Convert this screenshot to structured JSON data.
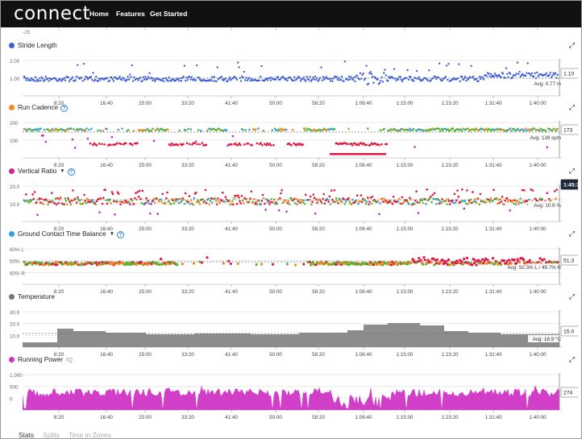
{
  "header": {
    "logo_text": "connect",
    "nav": [
      "Home",
      "Features",
      "Get Started"
    ]
  },
  "x_ticks": [
    "8:20",
    "16:40",
    "25:00",
    "33:20",
    "41:40",
    "50:00",
    "58:20",
    "1:06:40",
    "1:15:00",
    "1:23:20",
    "1:31:40",
    "1:40:00"
  ],
  "top_fragment": {
    "y_label": "-25"
  },
  "panels": [
    {
      "id": "stride-length",
      "title": "Stride Length",
      "dot_color": "#3b5fd8",
      "help": false,
      "dropdown": false,
      "io_label": "",
      "y_labels": [
        "2.00",
        "1.00"
      ],
      "avg_label": "Avg: 0.77 m",
      "value_tag": "1.10",
      "value_tag_dark": false
    },
    {
      "id": "run-cadence",
      "title": "Run Cadence",
      "dot_color": "#f28a1e",
      "help": true,
      "dropdown": false,
      "io_label": "",
      "y_labels": [
        "200",
        "100"
      ],
      "avg_label": "Avg: 139 spm",
      "value_tag": "173",
      "value_tag_dark": false
    },
    {
      "id": "vertical-ratio",
      "title": "Vertical Ratio",
      "dot_color": "#d6248e",
      "help": true,
      "dropdown": true,
      "io_label": "",
      "y_labels": [
        "20.0",
        "10.0"
      ],
      "avg_label": "Avg: 10.6 %",
      "value_tag": "1:45:32",
      "value_tag_dark": true
    },
    {
      "id": "ground-contact-time-balance",
      "title": "Ground Contact Time Balance",
      "dot_color": "#2ba3e4",
      "help": true,
      "dropdown": true,
      "io_label": "",
      "y_labels": [
        "60% L",
        "50%",
        "60% R"
      ],
      "avg_label": "Avg: 50.3% L / 49.7% R",
      "value_tag": "51.3",
      "value_tag_dark": false
    },
    {
      "id": "temperature",
      "title": "Temperature",
      "dot_color": "#777777",
      "help": false,
      "dropdown": false,
      "io_label": "",
      "y_labels": [
        "30.0",
        "20.0",
        "10.0"
      ],
      "avg_label": "Avg: 18.9 °C",
      "value_tag": "15.0",
      "value_tag_dark": false
    },
    {
      "id": "running-power",
      "title": "Running Power",
      "dot_color": "#d62ec4",
      "help": false,
      "dropdown": false,
      "io_label": "IQ",
      "y_labels": [
        "1,000",
        "500",
        "0"
      ],
      "avg_label": "",
      "value_tag": "274",
      "value_tag_dark": false
    }
  ],
  "bottom_tabs": [
    "Stats",
    "Splits",
    "Time in Zones"
  ],
  "colors": {
    "stride": "#3b5fd8",
    "cadence_red": "#e3173d",
    "cadence_orange": "#f28a1e",
    "cadence_green": "#5cb531",
    "cadence_blue": "#2ba3e4",
    "cadence_purple": "#b72ed6",
    "temperature_fill": "#8c8c8c",
    "power_fill": "#d13ec8",
    "grid": "#e6e6e6"
  }
}
